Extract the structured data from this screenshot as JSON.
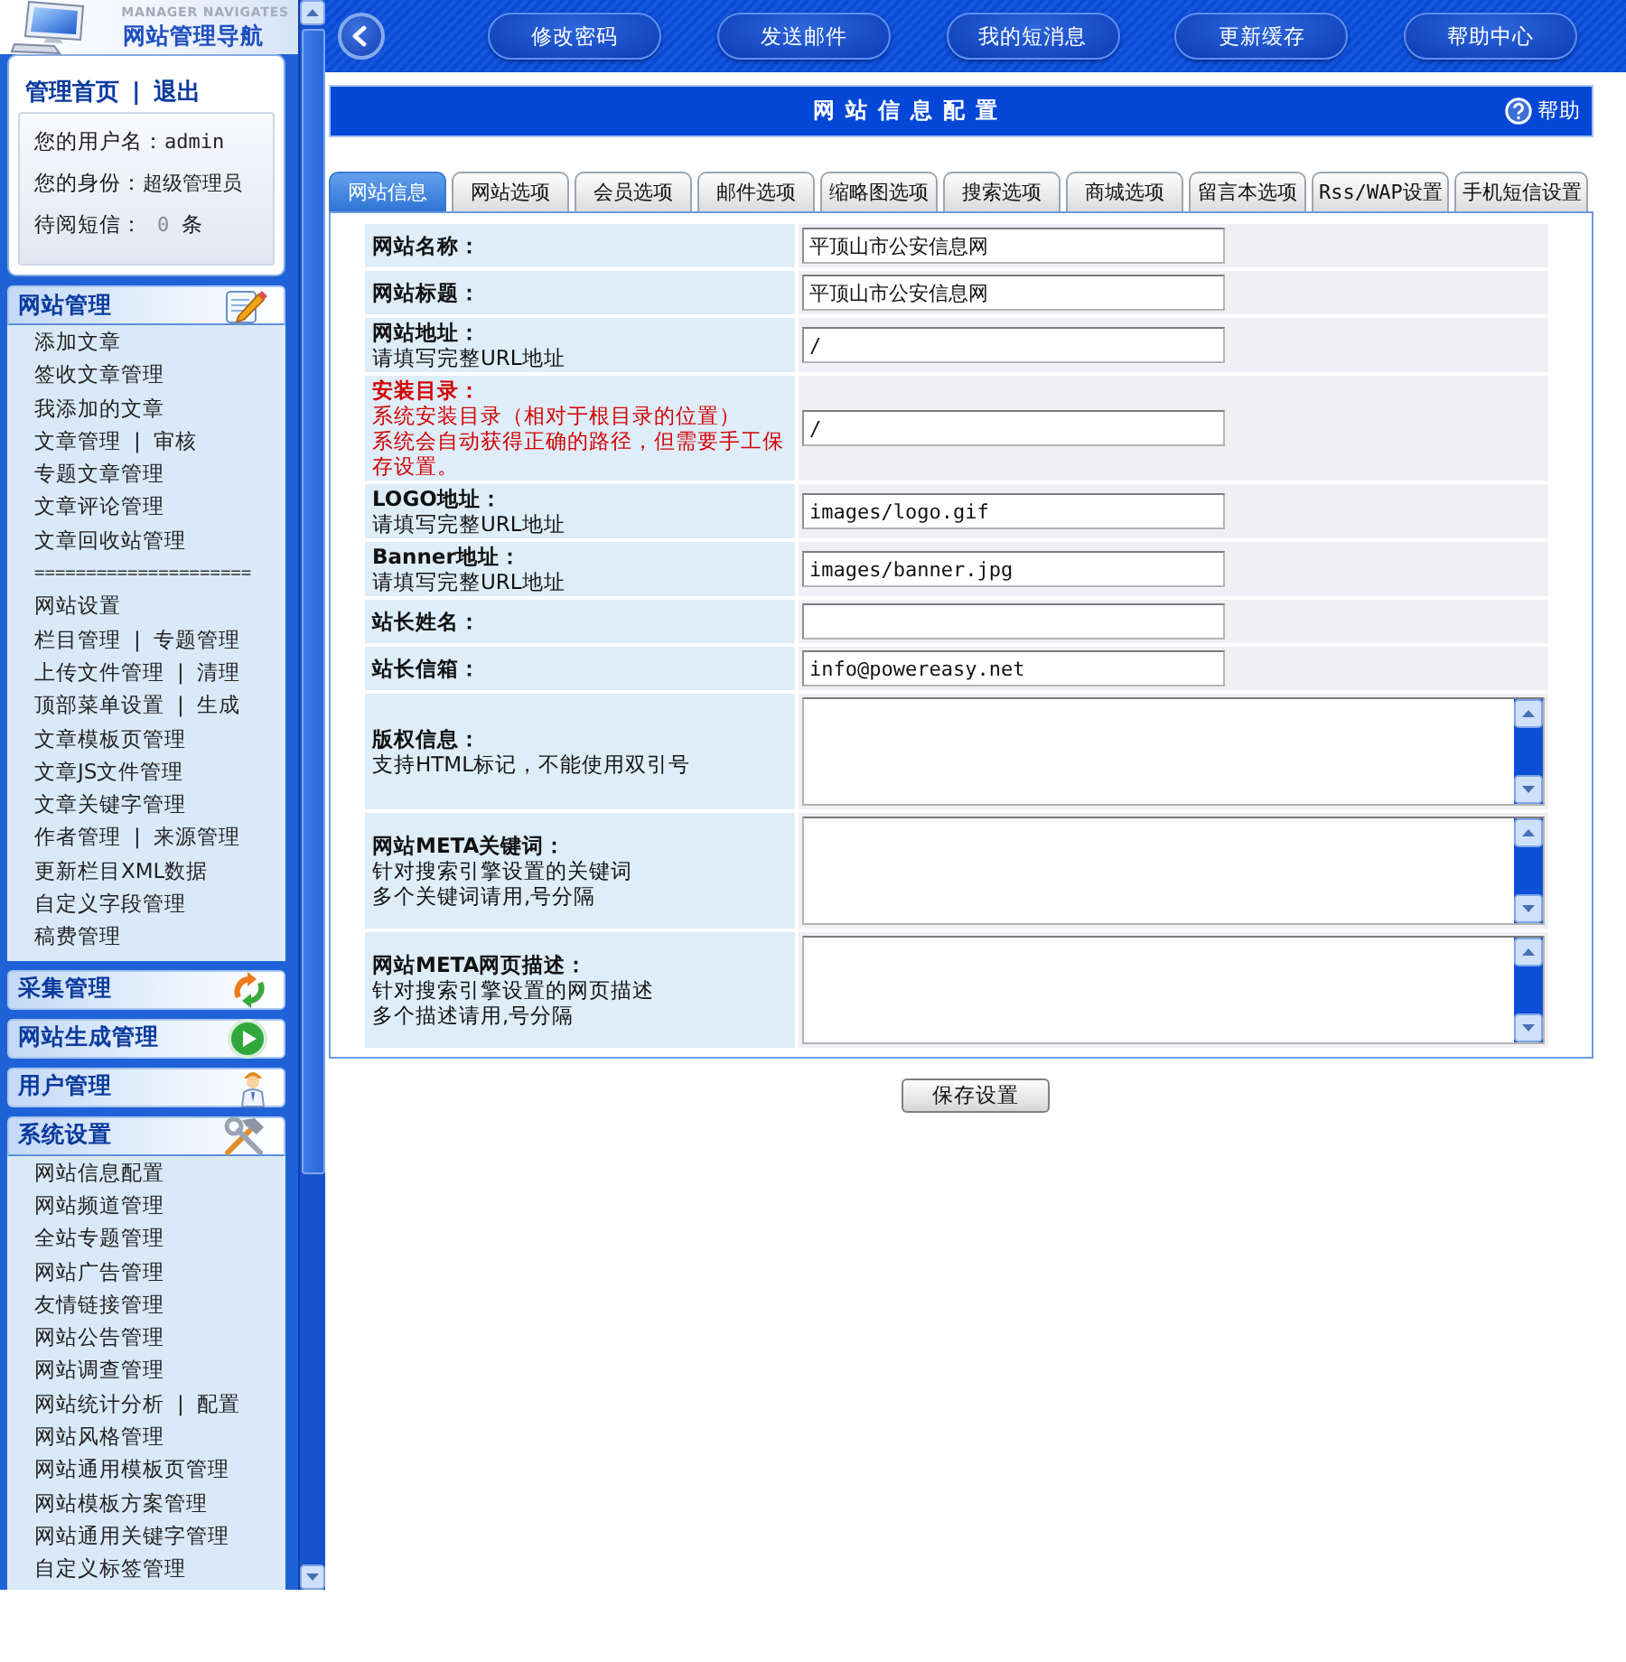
{
  "sidebar": {
    "header": {
      "subtitle": "MANAGER NAVIGATES",
      "title": "网站管理导航"
    },
    "account": {
      "links": [
        "管理首页",
        "退出"
      ],
      "separator": "|",
      "info": [
        {
          "label": "您的用户名：",
          "value": "admin"
        },
        {
          "label": "您的身份：",
          "value": "超级管理员"
        },
        {
          "label": "待阅短信：",
          "value": "0",
          "unit": "条"
        }
      ]
    },
    "sections": [
      {
        "title": "网站管理",
        "expanded": true,
        "items": [
          {
            "kind": "link",
            "links": [
              "添加文章"
            ]
          },
          {
            "kind": "link",
            "links": [
              "签收文章管理"
            ]
          },
          {
            "kind": "link",
            "links": [
              "我添加的文章"
            ]
          },
          {
            "kind": "link",
            "links": [
              "文章管理",
              "审核"
            ],
            "separator": "|"
          },
          {
            "kind": "link",
            "links": [
              "专题文章管理"
            ]
          },
          {
            "kind": "link",
            "links": [
              "文章评论管理"
            ]
          },
          {
            "kind": "link",
            "links": [
              "文章回收站管理"
            ]
          },
          {
            "kind": "rule",
            "text": "====================="
          },
          {
            "kind": "link",
            "links": [
              "网站设置"
            ]
          },
          {
            "kind": "link",
            "links": [
              "栏目管理",
              "专题管理"
            ],
            "separator": "|"
          },
          {
            "kind": "link",
            "links": [
              "上传文件管理",
              "清理"
            ],
            "separator": "|"
          },
          {
            "kind": "link",
            "links": [
              "顶部菜单设置",
              "生成"
            ],
            "separator": "|"
          },
          {
            "kind": "link",
            "links": [
              "文章模板页管理"
            ]
          },
          {
            "kind": "link",
            "links": [
              "文章JS文件管理"
            ]
          },
          {
            "kind": "link",
            "links": [
              "文章关键字管理"
            ]
          },
          {
            "kind": "link",
            "links": [
              "作者管理",
              "来源管理"
            ],
            "separator": "|"
          },
          {
            "kind": "link",
            "links": [
              "更新栏目XML数据"
            ]
          },
          {
            "kind": "link",
            "links": [
              "自定义字段管理"
            ]
          },
          {
            "kind": "link",
            "links": [
              "稿费管理"
            ]
          }
        ]
      },
      {
        "title": "采集管理",
        "expanded": false
      },
      {
        "title": "网站生成管理",
        "expanded": false
      },
      {
        "title": "用户管理",
        "expanded": false
      },
      {
        "title": "系统设置",
        "expanded": true,
        "items": [
          {
            "kind": "link",
            "links": [
              "网站信息配置"
            ]
          },
          {
            "kind": "link",
            "links": [
              "网站频道管理"
            ]
          },
          {
            "kind": "link",
            "links": [
              "全站专题管理"
            ]
          },
          {
            "kind": "link",
            "links": [
              "网站广告管理"
            ]
          },
          {
            "kind": "link",
            "links": [
              "友情链接管理"
            ]
          },
          {
            "kind": "link",
            "links": [
              "网站公告管理"
            ]
          },
          {
            "kind": "link",
            "links": [
              "网站调查管理"
            ]
          },
          {
            "kind": "link",
            "links": [
              "网站统计分析",
              "配置"
            ],
            "separator": "|"
          },
          {
            "kind": "link",
            "links": [
              "网站风格管理"
            ]
          },
          {
            "kind": "link",
            "links": [
              "网站通用模板页管理"
            ]
          },
          {
            "kind": "link",
            "links": [
              "网站模板方案管理"
            ]
          },
          {
            "kind": "link",
            "links": [
              "网站通用关键字管理"
            ]
          },
          {
            "kind": "link",
            "links": [
              "自定义标签管理"
            ]
          }
        ]
      }
    ]
  },
  "toolbar": {
    "buttons": [
      "修改密码",
      "发送邮件",
      "我的短消息",
      "更新缓存",
      "帮助中心"
    ]
  },
  "page": {
    "title": "网站信息配置",
    "help": "帮助",
    "tabs": [
      {
        "label": "网站信息",
        "selected": true
      },
      {
        "label": "网站选项",
        "selected": false
      },
      {
        "label": "会员选项",
        "selected": false
      },
      {
        "label": "邮件选项",
        "selected": false
      },
      {
        "label": "缩略图选项",
        "selected": false
      },
      {
        "label": "搜索选项",
        "selected": false
      },
      {
        "label": "商城选项",
        "selected": false
      },
      {
        "label": "留言本选项",
        "selected": false
      },
      {
        "label": "Rss/WAP设置",
        "selected": false
      },
      {
        "label": "手机短信设置",
        "selected": false
      }
    ],
    "rows": [
      {
        "kind": "input",
        "label": "网站名称：",
        "important": false,
        "value": "平顶山市公安信息网"
      },
      {
        "kind": "input",
        "label": "网站标题：",
        "important": false,
        "value": "平顶山市公安信息网"
      },
      {
        "kind": "input",
        "label": "网站地址：",
        "hints": [
          "请填写完整URL地址"
        ],
        "important": false,
        "value": "/"
      },
      {
        "kind": "input",
        "label": "安装目录：",
        "hints": [
          "系统安装目录（相对于根目录的位置）",
          "系统会自动获得正确的路径，但需要手工保存设置。"
        ],
        "important": true,
        "value": "/"
      },
      {
        "kind": "input",
        "label": "LOGO地址：",
        "hints": [
          "请填写完整URL地址"
        ],
        "important": false,
        "value": "images/logo.gif"
      },
      {
        "kind": "input",
        "label": "Banner地址：",
        "hints": [
          "请填写完整URL地址"
        ],
        "important": false,
        "value": "images/banner.jpg"
      },
      {
        "kind": "input",
        "label": "站长姓名：",
        "important": false
      },
      {
        "kind": "input",
        "label": "站长信箱：",
        "important": false,
        "value": "info@powereasy.net"
      },
      {
        "kind": "textarea",
        "label": "版权信息：",
        "hints": [
          "支持HTML标记，不能使用双引号"
        ],
        "important": false
      },
      {
        "kind": "textarea",
        "label": "网站META关键词：",
        "hints": [
          "针对搜索引擎设置的关键词",
          "多个关键词请用,号分隔"
        ],
        "important": false
      },
      {
        "kind": "textarea",
        "label": "网站META网页描述：",
        "hints": [
          "针对搜索引擎设置的网页描述",
          "多个描述请用,号分隔"
        ],
        "important": false
      }
    ],
    "submit": "保存设置"
  }
}
